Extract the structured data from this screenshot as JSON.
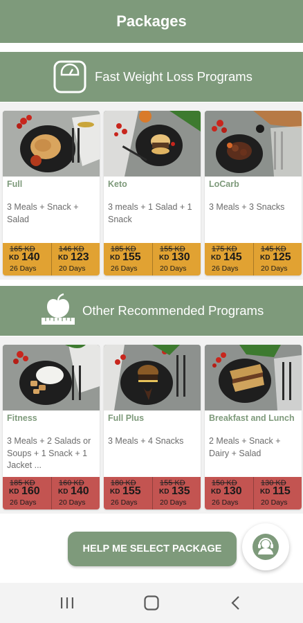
{
  "header": {
    "title": "Packages"
  },
  "sections": [
    {
      "title": "Fast Weight Loss Programs",
      "icon": "scale-icon"
    },
    {
      "title": "Other Recommended Programs",
      "icon": "apple-tape-icon"
    }
  ],
  "packages": [
    {
      "name": "Full",
      "desc": "3 Meals + Snack + Salad",
      "dish": "pasta",
      "prices": [
        {
          "old": "165 KD",
          "cur": "KD",
          "new": "140",
          "days": "26  Days"
        },
        {
          "old": "146 KD",
          "cur": "KD",
          "new": "123",
          "days": "20  Days"
        }
      ]
    },
    {
      "name": "Keto",
      "desc": "3 meals + 1 Salad + 1 Snack",
      "dish": "burger",
      "prices": [
        {
          "old": "185 KD",
          "cur": "KD",
          "new": "155",
          "days": "26  Days"
        },
        {
          "old": "155 KD",
          "cur": "KD",
          "new": "130",
          "days": "20  Days"
        }
      ]
    },
    {
      "name": "LoCarb",
      "desc": "3 Meals + 3 Snacks",
      "dish": "stew",
      "prices": [
        {
          "old": "175 KD",
          "cur": "KD",
          "new": "145",
          "days": "26  Days"
        },
        {
          "old": "145 KD",
          "cur": "KD",
          "new": "125",
          "days": "20  Days"
        }
      ]
    },
    {
      "name": "Fitness",
      "desc": "3 Meals + 2 Salads or Soups + 1 Snack + 1 Jacket ...",
      "dish": "rice",
      "prices": [
        {
          "old": "185 KD",
          "cur": "KD",
          "new": "160",
          "days": "26  Days"
        },
        {
          "old": "160 KD",
          "cur": "KD",
          "new": "140",
          "days": "20  Days"
        }
      ]
    },
    {
      "name": "Full Plus",
      "desc": "3 Meals + 4 Snacks",
      "dish": "burger2",
      "prices": [
        {
          "old": "180 KD",
          "cur": "KD",
          "new": "155",
          "days": "26  Days"
        },
        {
          "old": "155 KD",
          "cur": "KD",
          "new": "135",
          "days": "20  Days"
        }
      ]
    },
    {
      "name": "Breakfast and Lunch",
      "desc": "2 Meals + Snack + Dairy + Salad",
      "dish": "sandwich",
      "prices": [
        {
          "old": "150 KD",
          "cur": "KD",
          "new": "130",
          "days": "26  Days"
        },
        {
          "old": "130 KD",
          "cur": "KD",
          "new": "115",
          "days": "20  Days"
        }
      ]
    }
  ],
  "help_button": "HELP ME SELECT PACKAGE",
  "support_icon": "support-agent-icon",
  "nav": {
    "icons": [
      "recent-apps-icon",
      "home-icon",
      "back-icon"
    ]
  },
  "colors": {
    "accent": "#7e9a7b",
    "orange": "#e1a232",
    "red": "#c35451"
  }
}
